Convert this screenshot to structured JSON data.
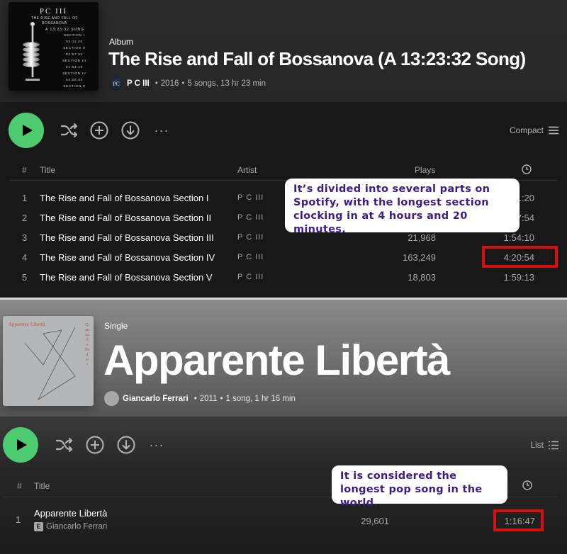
{
  "album": {
    "type_label": "Album",
    "title": "The Rise and Fall of Bossanova (A 13:23:32 Song)",
    "artist": "P C III",
    "year": "2016",
    "summary": "5 songs, 13 hr 23 min",
    "avatar_text": "PC",
    "cover": {
      "title": "PC III",
      "subtitle_line1": "THE RISE AND FALL OF",
      "subtitle_line2": "BOSSANOVA",
      "song_line": "A 13:23:32 SONG",
      "sections": [
        {
          "name": "SECTION I",
          "time": "02:11:20"
        },
        {
          "name": "SECTION II",
          "time": "02:57:54"
        },
        {
          "name": "SECTION III",
          "time": "01:54:10"
        },
        {
          "name": "SECTION IV",
          "time": "04:20:54"
        },
        {
          "name": "SECTION V",
          "time": "01:59:13"
        }
      ]
    },
    "controls": {
      "play": "play-icon",
      "shuffle": "shuffle-icon",
      "add": "plus-circle-icon",
      "download": "download-icon",
      "more": "···",
      "view_label": "Compact",
      "view_icon": "compact-list-icon"
    },
    "table": {
      "headers": {
        "num": "#",
        "title": "Title",
        "artist": "Artist",
        "plays": "Plays",
        "duration_icon": "clock-icon"
      },
      "rows": [
        {
          "num": "1",
          "title": "The Rise and Fall of Bossanova Section I",
          "artist": "P C III",
          "plays": "",
          "duration": "2:11:20"
        },
        {
          "num": "2",
          "title": "The Rise and Fall of Bossanova Section II",
          "artist": "P C III",
          "plays": "",
          "duration": "2:57:54"
        },
        {
          "num": "3",
          "title": "The Rise and Fall of Bossanova Section III",
          "artist": "P C III",
          "plays": "21,968",
          "duration": "1:54:10"
        },
        {
          "num": "4",
          "title": "The Rise and Fall of Bossanova Section IV",
          "artist": "P C III",
          "plays": "163,249",
          "duration": "4:20:54"
        },
        {
          "num": "5",
          "title": "The Rise and Fall of Bossanova Section V",
          "artist": "P C III",
          "plays": "18,803",
          "duration": "1:59:13"
        }
      ]
    },
    "callout": "It’s divided into several parts on Spotify, with the longest section clocking in at 4 hours and 20 minutes.",
    "highlight_color": "#d80f0f"
  },
  "single": {
    "type_label": "Single",
    "title": "Apparente Libertà",
    "artist": "Giancarlo Ferrari",
    "year": "2011",
    "summary": "1 song, 1 hr 16 min",
    "cover": {
      "title": "Apparente Libertà",
      "side_text": "Giancarlo Ferrari"
    },
    "controls": {
      "more": "···",
      "view_label": "List",
      "view_icon": "list-icon"
    },
    "table": {
      "headers": {
        "num": "#",
        "title": "Title",
        "duration_icon": "clock-icon"
      },
      "rows": [
        {
          "num": "1",
          "title": "Apparente Libertà",
          "explicit": "E",
          "artist": "Giancarlo Ferrari",
          "plays": "29,601",
          "duration": "1:16:47"
        }
      ]
    },
    "callout": "It is considered the longest pop song in the world."
  },
  "colors": {
    "play_green": "#4ecb71",
    "callout_text": "#3b1d8a",
    "highlight_red": "#d80f0f"
  }
}
